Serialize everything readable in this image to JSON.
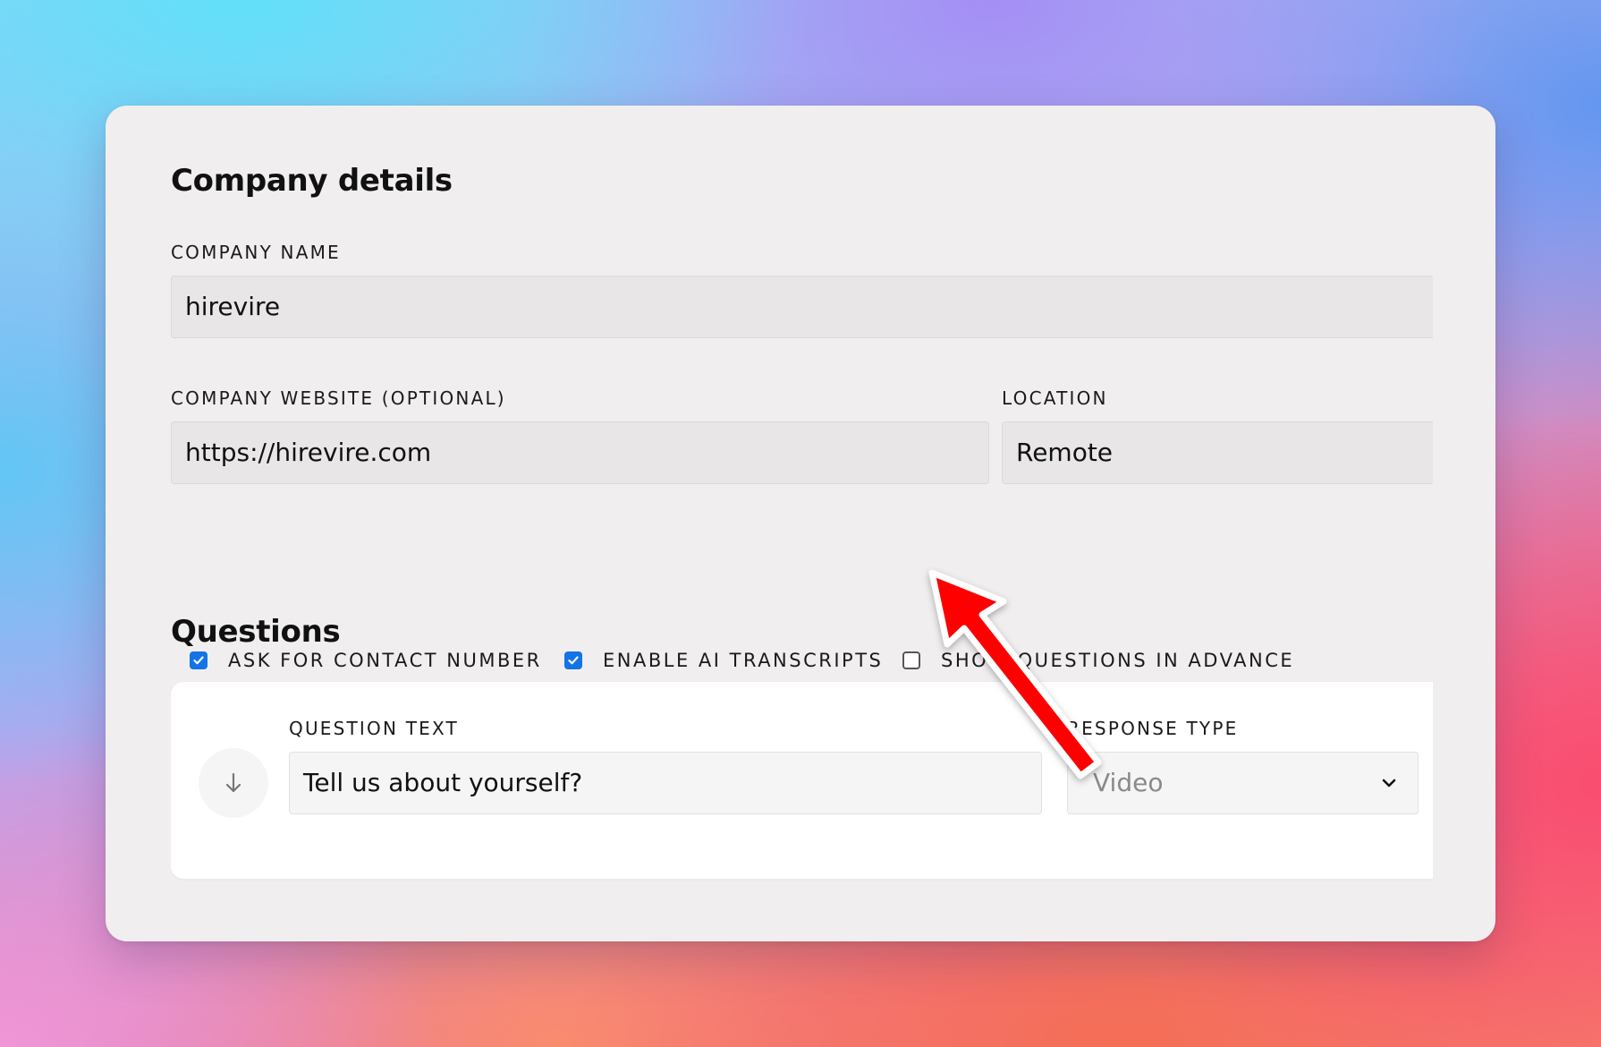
{
  "company_details": {
    "title": "Company details",
    "company_name_label": "COMPANY NAME",
    "company_name_value": "hirevire",
    "website_label": "COMPANY WEBSITE (OPTIONAL)",
    "website_value": "https://hirevire.com",
    "location_label": "LOCATION",
    "location_value": "Remote"
  },
  "options": [
    {
      "label": "ASK FOR CONTACT NUMBER",
      "checked": true
    },
    {
      "label": "ENABLE AI TRANSCRIPTS",
      "checked": true
    },
    {
      "label": "SHOW QUESTIONS IN ADVANCE",
      "checked": false
    }
  ],
  "questions": {
    "title": "Questions",
    "items": [
      {
        "question_text_label": "QUESTION TEXT",
        "question_text_value": "Tell us about yourself?",
        "response_type_label": "RESPONSE TYPE",
        "response_type_value": "Video"
      }
    ]
  },
  "colors": {
    "checkbox_checked": "#1473e6",
    "annotation_arrow": "#ff0000",
    "card_background": "#f1eeef"
  },
  "icons": {
    "reorder_handle": "arrow-down-icon",
    "select_caret": "chevron-down-icon",
    "checkmark": "checkmark-icon",
    "annotation": "red-arrow-annotation"
  }
}
